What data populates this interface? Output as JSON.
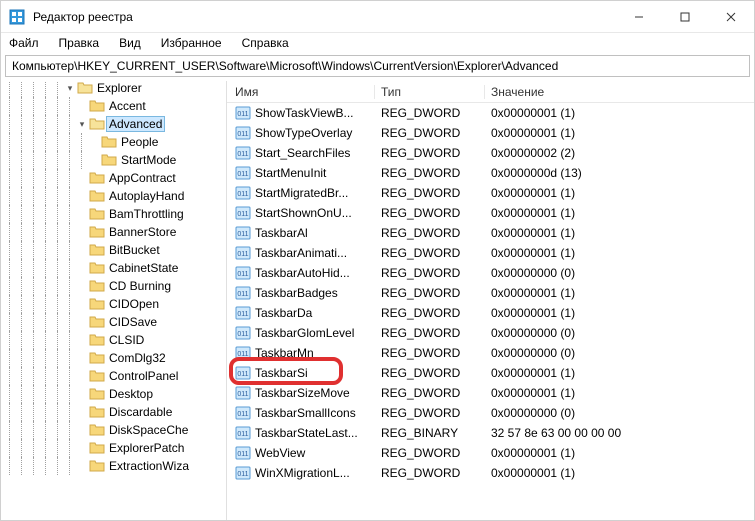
{
  "title": "Редактор реестра",
  "menu": [
    "Файл",
    "Правка",
    "Вид",
    "Избранное",
    "Справка"
  ],
  "address": "Компьютер\\HKEY_CURRENT_USER\\Software\\Microsoft\\Windows\\CurrentVersion\\Explorer\\Advanced",
  "columns": {
    "name": "Имя",
    "type": "Тип",
    "value": "Значение"
  },
  "tree": [
    {
      "indent": 5,
      "expander": "v",
      "open": true,
      "label": "Explorer"
    },
    {
      "indent": 6,
      "expander": "",
      "open": false,
      "label": "Accent"
    },
    {
      "indent": 6,
      "expander": "v",
      "open": true,
      "label": "Advanced",
      "selected": true
    },
    {
      "indent": 7,
      "expander": "",
      "open": false,
      "label": "People"
    },
    {
      "indent": 7,
      "expander": "",
      "open": false,
      "label": "StartMode"
    },
    {
      "indent": 6,
      "expander": "",
      "open": false,
      "label": "AppContract"
    },
    {
      "indent": 6,
      "expander": "",
      "open": false,
      "label": "AutoplayHand"
    },
    {
      "indent": 6,
      "expander": "",
      "open": false,
      "label": "BamThrottling"
    },
    {
      "indent": 6,
      "expander": "",
      "open": false,
      "label": "BannerStore"
    },
    {
      "indent": 6,
      "expander": "",
      "open": false,
      "label": "BitBucket"
    },
    {
      "indent": 6,
      "expander": "",
      "open": false,
      "label": "CabinetState"
    },
    {
      "indent": 6,
      "expander": "",
      "open": false,
      "label": "CD Burning"
    },
    {
      "indent": 6,
      "expander": "",
      "open": false,
      "label": "CIDOpen"
    },
    {
      "indent": 6,
      "expander": "",
      "open": false,
      "label": "CIDSave"
    },
    {
      "indent": 6,
      "expander": "",
      "open": false,
      "label": "CLSID"
    },
    {
      "indent": 6,
      "expander": "",
      "open": false,
      "label": "ComDlg32"
    },
    {
      "indent": 6,
      "expander": "",
      "open": false,
      "label": "ControlPanel"
    },
    {
      "indent": 6,
      "expander": "",
      "open": false,
      "label": "Desktop"
    },
    {
      "indent": 6,
      "expander": "",
      "open": false,
      "label": "Discardable"
    },
    {
      "indent": 6,
      "expander": "",
      "open": false,
      "label": "DiskSpaceChe"
    },
    {
      "indent": 6,
      "expander": "",
      "open": false,
      "label": "ExplorerPatch"
    },
    {
      "indent": 6,
      "expander": "",
      "open": false,
      "label": "ExtractionWiza"
    }
  ],
  "values": [
    {
      "name": "ShowTaskViewB...",
      "type": "REG_DWORD",
      "value": "0x00000001 (1)"
    },
    {
      "name": "ShowTypeOverlay",
      "type": "REG_DWORD",
      "value": "0x00000001 (1)"
    },
    {
      "name": "Start_SearchFiles",
      "type": "REG_DWORD",
      "value": "0x00000002 (2)"
    },
    {
      "name": "StartMenuInit",
      "type": "REG_DWORD",
      "value": "0x0000000d (13)"
    },
    {
      "name": "StartMigratedBr...",
      "type": "REG_DWORD",
      "value": "0x00000001 (1)"
    },
    {
      "name": "StartShownOnU...",
      "type": "REG_DWORD",
      "value": "0x00000001 (1)"
    },
    {
      "name": "TaskbarAl",
      "type": "REG_DWORD",
      "value": "0x00000001 (1)"
    },
    {
      "name": "TaskbarAnimati...",
      "type": "REG_DWORD",
      "value": "0x00000001 (1)"
    },
    {
      "name": "TaskbarAutoHid...",
      "type": "REG_DWORD",
      "value": "0x00000000 (0)"
    },
    {
      "name": "TaskbarBadges",
      "type": "REG_DWORD",
      "value": "0x00000001 (1)"
    },
    {
      "name": "TaskbarDa",
      "type": "REG_DWORD",
      "value": "0x00000001 (1)"
    },
    {
      "name": "TaskbarGlomLevel",
      "type": "REG_DWORD",
      "value": "0x00000000 (0)"
    },
    {
      "name": "TaskbarMn",
      "type": "REG_DWORD",
      "value": "0x00000000 (0)"
    },
    {
      "name": "TaskbarSi",
      "type": "REG_DWORD",
      "value": "0x00000001 (1)",
      "highlighted": true
    },
    {
      "name": "TaskbarSizeMove",
      "type": "REG_DWORD",
      "value": "0x00000001 (1)"
    },
    {
      "name": "TaskbarSmallIcons",
      "type": "REG_DWORD",
      "value": "0x00000000 (0)"
    },
    {
      "name": "TaskbarStateLast...",
      "type": "REG_BINARY",
      "value": "32 57 8e 63 00 00 00 00"
    },
    {
      "name": "WebView",
      "type": "REG_DWORD",
      "value": "0x00000001 (1)"
    },
    {
      "name": "WinXMigrationL...",
      "type": "REG_DWORD",
      "value": "0x00000001 (1)"
    }
  ]
}
